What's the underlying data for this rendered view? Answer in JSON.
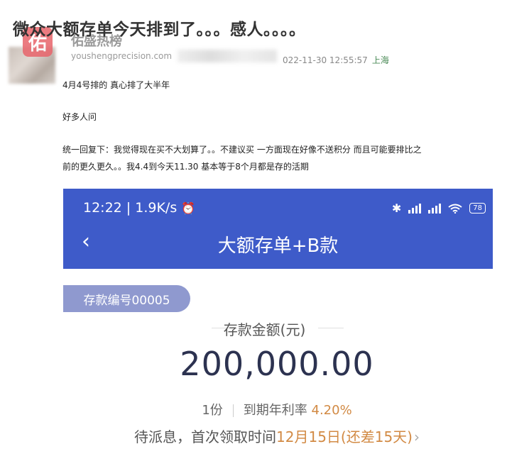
{
  "post": {
    "title": "微众大额存单今天排到了。。。感人。。。。",
    "watermark_name": "佑盛热榜",
    "watermark_url": "youshengprecision.com",
    "watermark_logo": "佑",
    "timestamp": "022-11-30 12:55:57",
    "location": "上海",
    "lines": [
      "4月4号排的 真心排了大半年",
      "好多人问",
      "统一回复下：我觉得现在买不大划算了。。不建议买  一方面现在好像不送积分 而且可能要排比之",
      "前的更久更久。。我4.4到今天11.30 基本等于8个月都是存的活期"
    ]
  },
  "screenshot": {
    "status_time": "12:22 | 1.9K/s",
    "alarm_icon": "⏰",
    "bluetooth_icon": "✱",
    "wifi_icon": "wifi-icon",
    "battery": "78",
    "back_icon": "‹",
    "nav_title": "大额存单+B款",
    "deposit_no": "存款编号00005",
    "amount_label": "存款金额(元)",
    "amount": "200,000.00",
    "shares": "1份",
    "rate_label": "到期年利率",
    "rate": "4.20%",
    "interest_prefix": "待派息，首次领取时间",
    "interest_date": "12月15日",
    "interest_suffix": "(还差15天)",
    "chevron": "›",
    "colors": {
      "header_bg": "#3e5bc9",
      "tag_bg": "#8f99cf",
      "accent": "#d28a44"
    }
  }
}
